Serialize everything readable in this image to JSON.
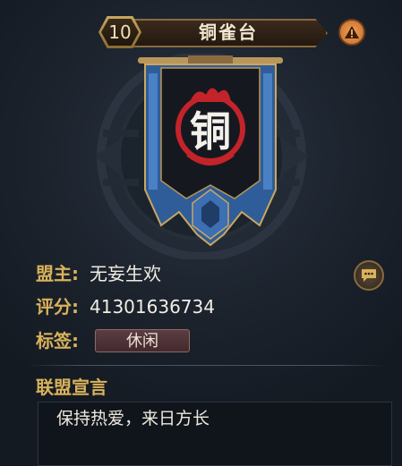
{
  "header": {
    "level": "10",
    "title": "铜雀台"
  },
  "banner": {
    "character": "铜"
  },
  "info": {
    "leader_label": "盟主:",
    "leader_value": "无妄生欢",
    "score_label": "评分:",
    "score_value": "41301636734",
    "tags_label": "标签:",
    "tag_value": "休闲"
  },
  "declaration": {
    "title": "联盟宣言",
    "text": "保持热爱，来日方长"
  },
  "icons": {
    "warning": "warning-icon",
    "chat": "chat-bubble-icon"
  },
  "colors": {
    "accent_gold": "#d9b25b",
    "banner_blue": "#3c6fb3",
    "flame_red": "#c4232a",
    "warning_orange": "#e0883f"
  }
}
